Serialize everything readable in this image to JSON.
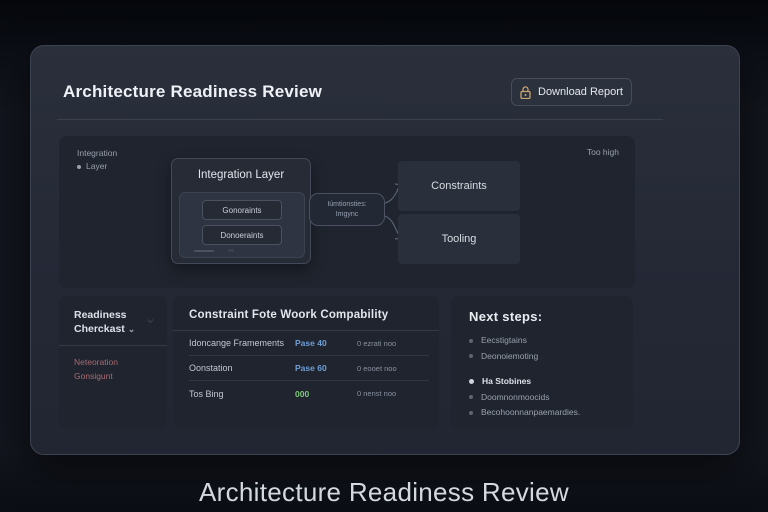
{
  "header": {
    "title": "Architecture Readiness Review",
    "download_report_label": "Download Report"
  },
  "diagram": {
    "legend_line1": "Integration",
    "legend_line2": "Layer",
    "corner_label": "Too high",
    "integration_layer": {
      "title": "Integration Layer",
      "sub_boxes": [
        {
          "label": "Gonoraints"
        },
        {
          "label": "Donoeraints"
        }
      ]
    },
    "connector_label": {
      "line1": "Iúmtionsties:",
      "line2": "Imgync"
    },
    "nodes": {
      "constraints": "Constraints",
      "tooling": "Tooling"
    }
  },
  "checklist": {
    "title_line1": "Readiness",
    "title_line2": "Cherckast",
    "chevron_glyph": "⌄",
    "items": [
      {
        "label": "Neteoration"
      },
      {
        "label": "Gonsigunt"
      }
    ]
  },
  "compat_table": {
    "title": "Constraint Fote Woork Compability",
    "rows": [
      {
        "label": "Idoncange Framements",
        "value": "Pase 40",
        "status": "0 ezrati noo"
      },
      {
        "label": "Oonstation",
        "value": "Pase 60",
        "status": "0 eooet noo"
      },
      {
        "label": "Tos Bing",
        "value": "000",
        "status": "0 nenst noo"
      }
    ]
  },
  "next_steps": {
    "title": "Next steps:",
    "items": [
      {
        "label": "Eecstigtains"
      },
      {
        "label": "Deonoiemoting"
      },
      {
        "label": "Ha Stobines"
      },
      {
        "label": "Doomnonmoocids"
      },
      {
        "label": "Becohoonnanpaemardies."
      }
    ]
  },
  "caption": "Architecture Readiness Review",
  "colors": {
    "lock_icon_gold": "#c9a36d",
    "value_blue": "#6f9fd8",
    "value_green": "#7ec97a",
    "checklist_pink": "#a86b72",
    "card_background": "#262b36",
    "panel_background": "#1f242e"
  }
}
